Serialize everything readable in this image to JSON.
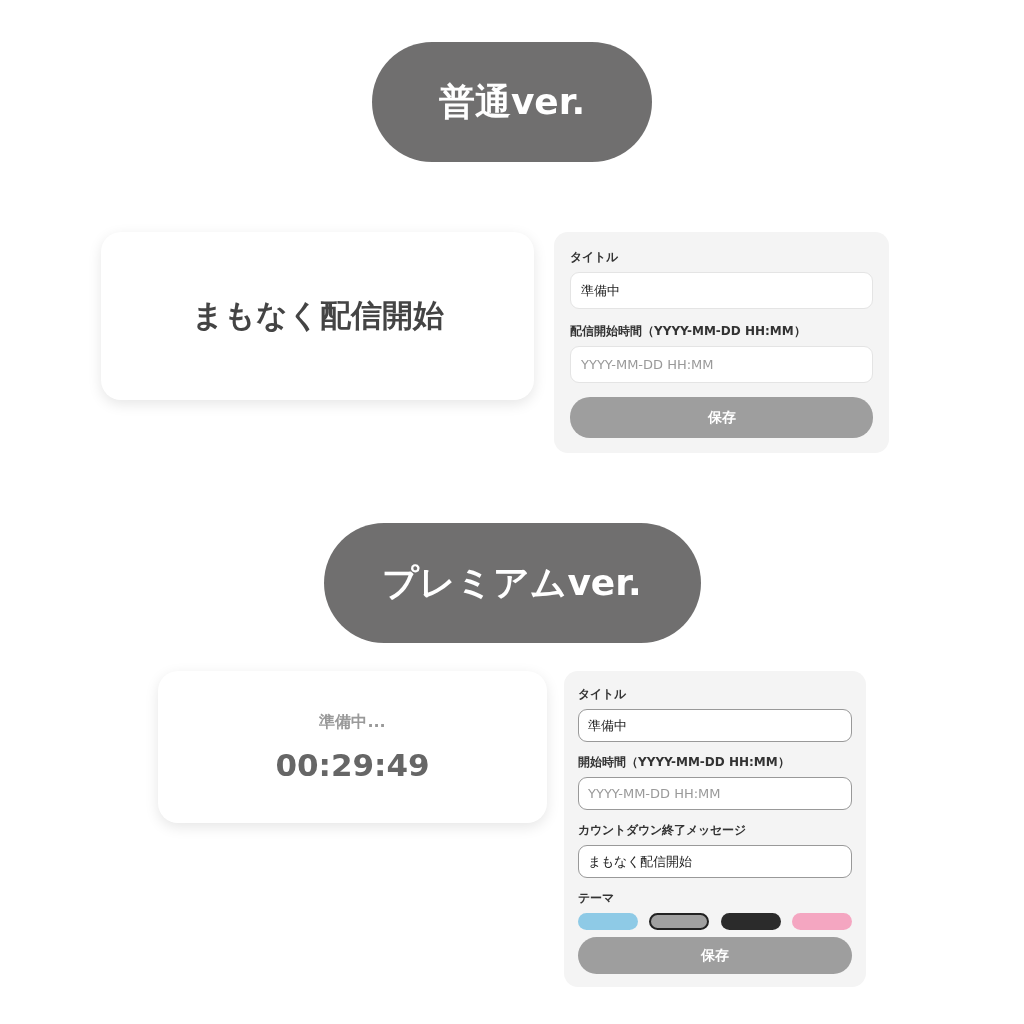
{
  "sections": [
    {
      "kind": "basic",
      "heading": "普通ver.",
      "preview": {
        "kind": "message",
        "message": "まもなく配信開始"
      },
      "form": {
        "fields": [
          {
            "label": "タイトル",
            "value": "準備中"
          },
          {
            "label": "配信開始時間（YYYY-MM-DD HH:MM）",
            "placeholder": "YYYY-MM-DD HH:MM"
          }
        ],
        "save_button": "保存"
      }
    },
    {
      "kind": "premium",
      "heading": "プレミアムver.",
      "preview": {
        "kind": "countdown",
        "status": "準備中...",
        "time": "00:29:49"
      },
      "form": {
        "fields": [
          {
            "label": "タイトル",
            "value": "準備中"
          },
          {
            "label": "開始時間（YYYY-MM-DD HH:MM）",
            "placeholder": "YYYY-MM-DD HH:MM"
          },
          {
            "label": "カウントダウン終了メッセージ",
            "value": "まもなく配信開始"
          }
        ],
        "theme": {
          "label": "テーマ",
          "swatches": [
            {
              "color": "#8ecae6",
              "selected": false
            },
            {
              "color": "#a0a0a0",
              "selected": true
            },
            {
              "color": "#2b2b2b",
              "selected": false
            },
            {
              "color": "#f4a6c1",
              "selected": false
            }
          ]
        },
        "save_button": "保存"
      }
    }
  ]
}
